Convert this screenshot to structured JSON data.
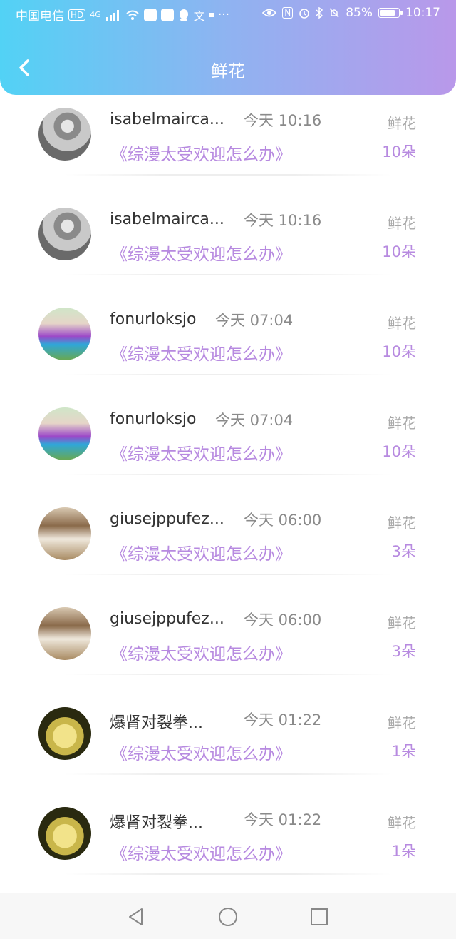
{
  "status_bar": {
    "carrier": "中国电信",
    "hd_badge": "HD",
    "network": "4G",
    "battery_percent": "85%",
    "time": "10:17",
    "icons": [
      "wifi-icon",
      "app-icon",
      "app-icon",
      "qq-icon",
      "translate-icon",
      "dot-icon",
      "more-icon",
      "eye-icon",
      "nfc-icon",
      "alarm-icon",
      "bluetooth-icon",
      "mute-icon",
      "battery-icon"
    ]
  },
  "header": {
    "title": "鲜花",
    "back_icon": "chevron-left-icon"
  },
  "items": [
    {
      "username": "isabelmairca...",
      "time": "今天 10:16",
      "kind": "鲜花",
      "book": "《综漫太受欢迎怎么办》",
      "count": "10朵",
      "avatar": "avatar-a"
    },
    {
      "username": "isabelmairca...",
      "time": "今天 10:16",
      "kind": "鲜花",
      "book": "《综漫太受欢迎怎么办》",
      "count": "10朵",
      "avatar": "avatar-a"
    },
    {
      "username": "fonurloksjo",
      "time": "今天 07:04",
      "kind": "鲜花",
      "book": "《综漫太受欢迎怎么办》",
      "count": "10朵",
      "avatar": "avatar-b"
    },
    {
      "username": "fonurloksjo",
      "time": "今天 07:04",
      "kind": "鲜花",
      "book": "《综漫太受欢迎怎么办》",
      "count": "10朵",
      "avatar": "avatar-b"
    },
    {
      "username": "giusejppufez...",
      "time": "今天 06:00",
      "kind": "鲜花",
      "book": "《综漫太受欢迎怎么办》",
      "count": "3朵",
      "avatar": "avatar-c"
    },
    {
      "username": "giusejppufez...",
      "time": "今天 06:00",
      "kind": "鲜花",
      "book": "《综漫太受欢迎怎么办》",
      "count": "3朵",
      "avatar": "avatar-c"
    },
    {
      "username": "爆肾对裂拳...",
      "time": "今天 01:22",
      "kind": "鲜花",
      "book": "《综漫太受欢迎怎么办》",
      "count": "1朵",
      "avatar": "avatar-d"
    },
    {
      "username": "爆肾对裂拳...",
      "time": "今天 01:22",
      "kind": "鲜花",
      "book": "《综漫太受欢迎怎么办》",
      "count": "1朵",
      "avatar": "avatar-d"
    }
  ],
  "navbar": {
    "back": "triangle-back-icon",
    "home": "circle-home-icon",
    "recent": "square-recent-icon"
  },
  "colors": {
    "accent": "#b78ae0",
    "header_start": "#52d2f5",
    "header_end": "#b998ea"
  }
}
